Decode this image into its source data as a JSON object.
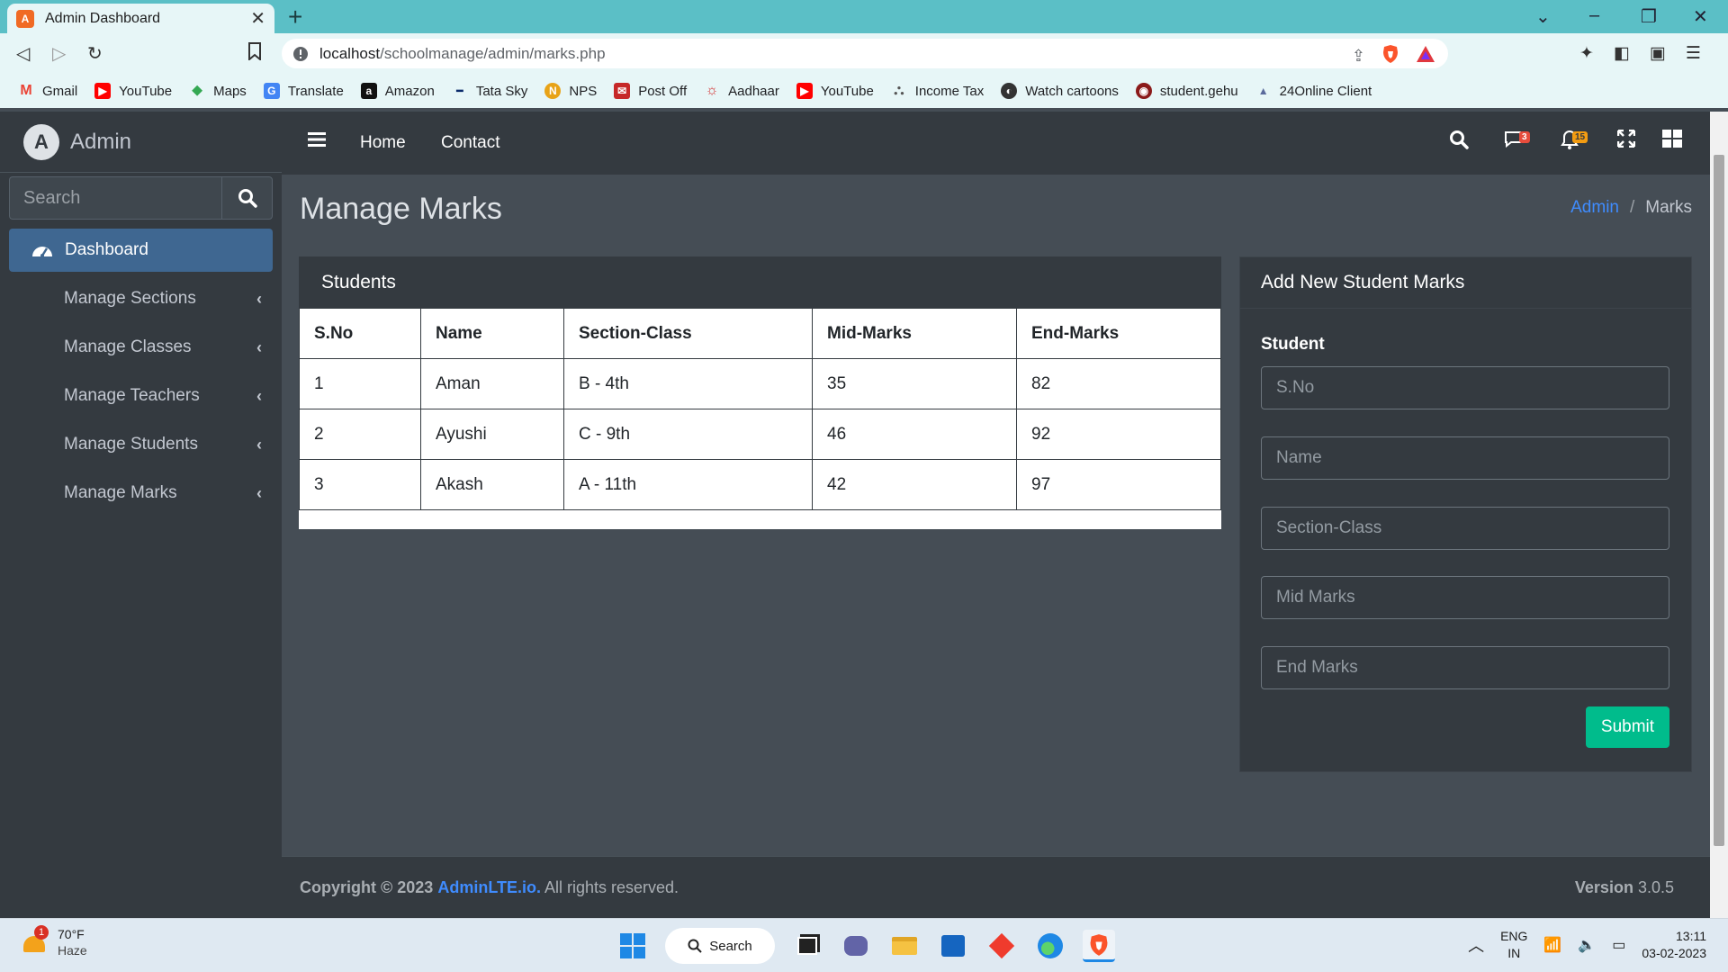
{
  "browser": {
    "tab_title": "Admin Dashboard",
    "tab_favicon": "AdminLTE",
    "url_host": "localhost",
    "url_path": "/schoolmanage/admin/marks.php",
    "bookmarks": [
      "Gmail",
      "YouTube",
      "Maps",
      "Translate",
      "Amazon",
      "Tata Sky",
      "NPS",
      "Post Off",
      "Aadhaar",
      "YouTube",
      "Income Tax",
      "Watch cartoons",
      "student.gehu",
      "24Online Client"
    ]
  },
  "sidebar": {
    "brand": "Admin",
    "search_placeholder": "Search",
    "active_item": "Dashboard",
    "items": [
      "Manage Sections",
      "Manage Classes",
      "Manage Teachers",
      "Manage Students",
      "Manage Marks"
    ]
  },
  "topnav": {
    "links": [
      "Home",
      "Contact"
    ],
    "messages_badge": "3",
    "notifications_badge": "15"
  },
  "page": {
    "title": "Manage Marks",
    "breadcrumb_link": "Admin",
    "breadcrumb_sep": "/",
    "breadcrumb_current": "Marks"
  },
  "students_card": {
    "title": "Students",
    "columns": [
      "S.No",
      "Name",
      "Section-Class",
      "Mid-Marks",
      "End-Marks"
    ],
    "rows": [
      [
        "1",
        "Aman",
        "B - 4th",
        "35",
        "82"
      ],
      [
        "2",
        "Ayushi",
        "C - 9th",
        "46",
        "92"
      ],
      [
        "3",
        "Akash",
        "A - 11th",
        "42",
        "97"
      ]
    ]
  },
  "form_card": {
    "title": "Add New Student Marks",
    "label": "Student",
    "placeholders": [
      "S.No",
      "Name",
      "Section-Class",
      "Mid Marks",
      "End Marks"
    ],
    "submit": "Submit"
  },
  "footer": {
    "copyright": "Copyright © 2023",
    "link": "AdminLTE.io.",
    "rights": "All rights reserved.",
    "version_label": "Version",
    "version": "3.0.5"
  },
  "taskbar": {
    "weather_badge": "1",
    "temperature": "70°F",
    "condition": "Haze",
    "search": "Search",
    "lang": "ENG",
    "region": "IN",
    "time": "13:11",
    "date": "03-02-2023"
  },
  "colors": {
    "sidebar_bg": "#343a40",
    "content_bg": "#454d55",
    "active_nav": "#3f6791",
    "submit": "#00bc8c",
    "link": "#3f8cff",
    "browser_accent": "#5bbfc6"
  }
}
